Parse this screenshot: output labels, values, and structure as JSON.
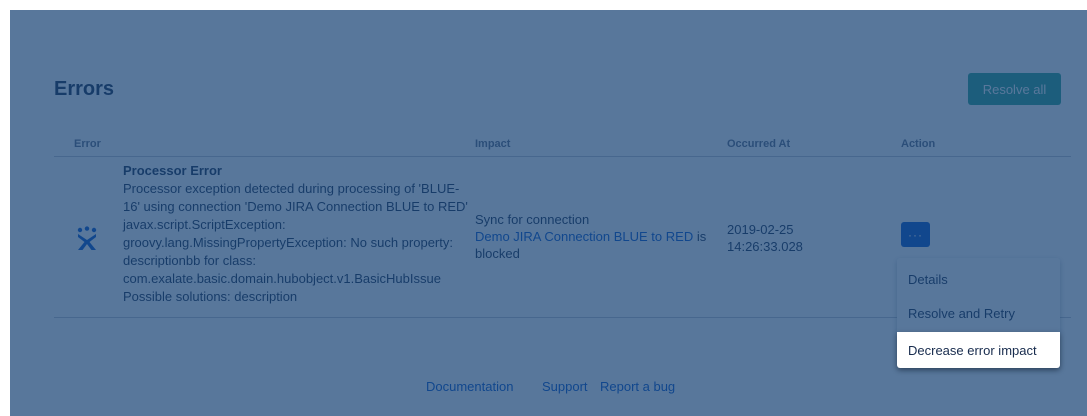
{
  "page": {
    "title": "Errors",
    "resolve_all_label": "Resolve all"
  },
  "table": {
    "headers": {
      "error": "Error",
      "impact": "Impact",
      "occurred_at": "Occurred At",
      "action": "Action"
    },
    "rows": [
      {
        "icon": "jira-logo-icon",
        "error_title": "Processor Error",
        "error_detail": "Processor exception detected during processing of 'BLUE-16' using connection 'Demo JIRA Connection BLUE to RED' javax.script.ScriptException: groovy.lang.MissingPropertyException: No such property: descriptionbb for class: com.exalate.basic.domain.hubobject.v1.BasicHubIssue Possible solutions: description",
        "impact_prefix": "Sync for connection",
        "impact_link": "Demo JIRA Connection BLUE to RED",
        "impact_suffix_1": "is",
        "impact_suffix_2": "blocked",
        "occurred_date": "2019-02-25",
        "occurred_time": "14:26:33.028",
        "action_button": "···"
      }
    ]
  },
  "action_menu": {
    "items": [
      "Details",
      "Resolve and Retry",
      "Decrease error impact"
    ],
    "highlighted": "Decrease error impact"
  },
  "footer": {
    "links": [
      "Documentation",
      "Support",
      "Report a bug"
    ]
  },
  "colors": {
    "overlay": "#174375",
    "primary_button": "#0052cc",
    "resolve_all_button": "#2aa38f",
    "link": "#0052cc"
  }
}
